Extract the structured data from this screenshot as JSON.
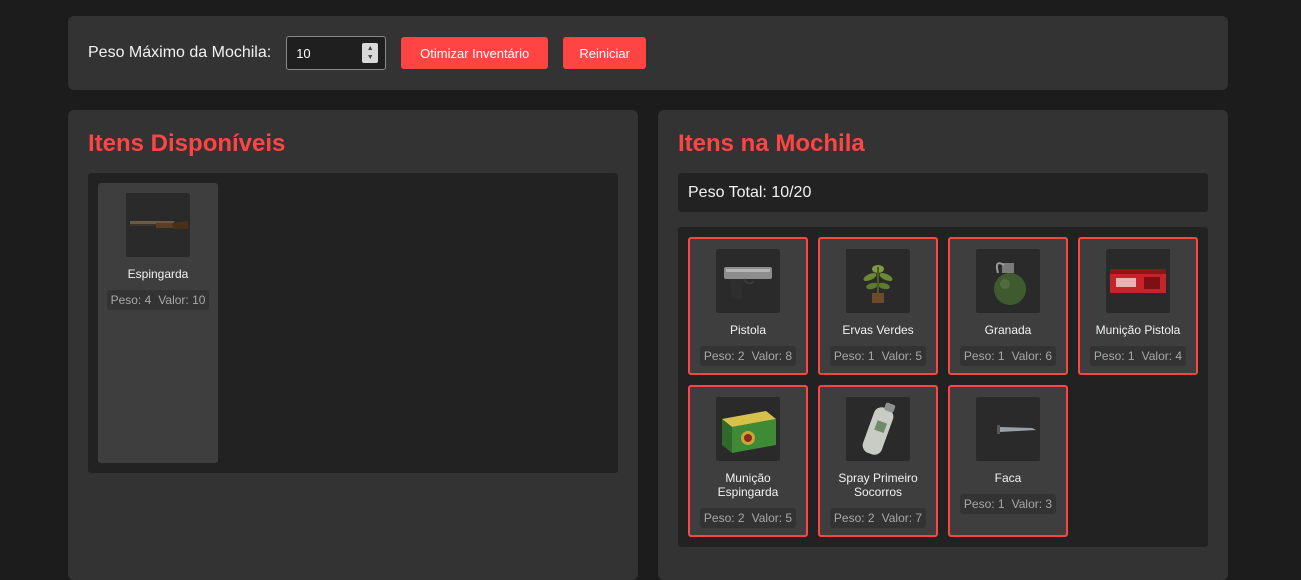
{
  "toolbar": {
    "max_weight_label": "Peso Máximo da Mochila:",
    "max_weight_value": "10",
    "optimize_label": "Otimizar Inventário",
    "reset_label": "Reiniciar",
    "accent_color": "#ff4444"
  },
  "available": {
    "title": "Itens Disponíveis",
    "items": [
      {
        "name": "Espingarda",
        "weight": "Peso: 4",
        "value": "Valor: 10",
        "icon": "shotgun-icon"
      }
    ]
  },
  "backpack": {
    "title": "Itens na Mochila",
    "total_weight": "Peso Total: 10/20",
    "items": [
      {
        "name": "Pistola",
        "weight": "Peso: 2",
        "value": "Valor: 8",
        "icon": "pistol-icon"
      },
      {
        "name": "Ervas Verdes",
        "weight": "Peso: 1",
        "value": "Valor: 5",
        "icon": "herb-icon"
      },
      {
        "name": "Granada",
        "weight": "Peso: 1",
        "value": "Valor: 6",
        "icon": "grenade-icon"
      },
      {
        "name": "Munição Pistola",
        "weight": "Peso: 1",
        "value": "Valor: 4",
        "icon": "pistol-ammo-icon"
      },
      {
        "name": "Munição Espingarda",
        "weight": "Peso: 2",
        "value": "Valor: 5",
        "icon": "shotgun-ammo-icon"
      },
      {
        "name": "Spray Primeiro Socorros",
        "weight": "Peso: 2",
        "value": "Valor: 7",
        "icon": "first-aid-spray-icon"
      },
      {
        "name": "Faca",
        "weight": "Peso: 1",
        "value": "Valor: 3",
        "icon": "knife-icon"
      }
    ]
  }
}
